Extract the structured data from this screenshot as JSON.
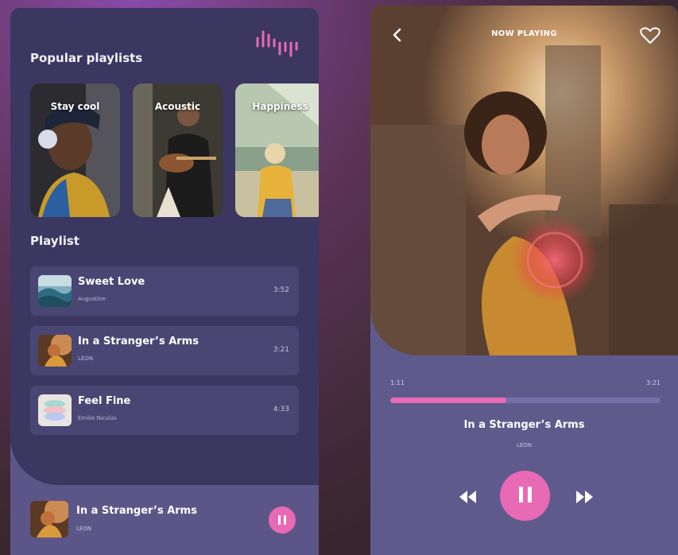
{
  "left": {
    "popular_title": "Popular playlists",
    "cards": [
      {
        "label": "Stay cool",
        "image": "boy-with-headphones-photo"
      },
      {
        "label": "Acoustic",
        "image": "guitarist-photo"
      },
      {
        "label": "Happiness",
        "image": "girl-in-field-photo"
      }
    ],
    "playlist_title": "Playlist",
    "songs": [
      {
        "title": "Sweet Love",
        "artist": "Augustine",
        "duration": "3:52",
        "thumb": "ocean-wave-thumb"
      },
      {
        "title": "In a Stranger’s Arms",
        "artist": "LÉON",
        "duration": "3:21",
        "thumb": "girl-sunset-thumb"
      },
      {
        "title": "Feel Fine",
        "artist": "Emilie Nicolas",
        "duration": "4:33",
        "thumb": "pastel-stack-thumb"
      }
    ],
    "now_playing": {
      "title": "In a Stranger’s Arms",
      "artist": "LÉON"
    }
  },
  "right": {
    "header_title": "NOW PLAYING",
    "elapsed": "1:11",
    "total": "3:21",
    "progress": 0.43,
    "song_title": "In a Stranger’s Arms",
    "artist": "LÉON"
  },
  "colors": {
    "accent": "#e86ab4",
    "panel_dark": "#3b3760",
    "panel_light": "#5c5688",
    "item_bg": "#4a4673"
  }
}
